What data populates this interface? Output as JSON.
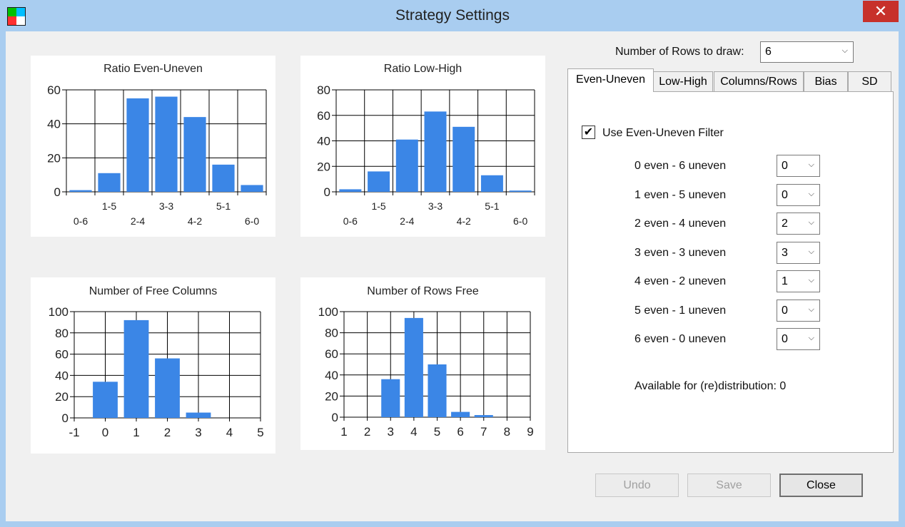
{
  "window": {
    "title": "Strategy Settings",
    "close_glyph": "✕"
  },
  "rows_to_draw": {
    "label": "Number of Rows to draw:",
    "value": "6"
  },
  "tabs": [
    {
      "label": "Even-Uneven",
      "active": true
    },
    {
      "label": "Low-High",
      "active": false
    },
    {
      "label": "Columns/Rows",
      "active": false
    },
    {
      "label": "Bias",
      "active": false
    },
    {
      "label": "SD",
      "active": false
    }
  ],
  "filter": {
    "checkbox_label": "Use Even-Uneven Filter",
    "checked": true,
    "rows": [
      {
        "label": "0 even - 6 uneven",
        "value": "0"
      },
      {
        "label": "1 even - 5 uneven",
        "value": "0"
      },
      {
        "label": "2 even - 4 uneven",
        "value": "2"
      },
      {
        "label": "3 even - 3 uneven",
        "value": "3"
      },
      {
        "label": "4 even - 2 uneven",
        "value": "1"
      },
      {
        "label": "5 even - 1 uneven",
        "value": "0"
      },
      {
        "label": "6 even - 0 uneven",
        "value": "0"
      }
    ],
    "available": "Available for (re)distribution: 0"
  },
  "buttons": {
    "undo": "Undo",
    "save": "Save",
    "close": "Close"
  },
  "chart_data": [
    {
      "type": "bar",
      "title": "Ratio Even-Uneven",
      "categories": [
        "0-6",
        "1-5",
        "2-4",
        "3-3",
        "4-2",
        "5-1",
        "6-0"
      ],
      "values": [
        1,
        11,
        55,
        56,
        44,
        16,
        4
      ],
      "ylim": [
        0,
        60
      ],
      "yticks": [
        0,
        20,
        40,
        60
      ],
      "grid": true
    },
    {
      "type": "bar",
      "title": "Ratio Low-High",
      "categories": [
        "0-6",
        "1-5",
        "2-4",
        "3-3",
        "4-2",
        "5-1",
        "6-0"
      ],
      "values": [
        2,
        16,
        41,
        63,
        51,
        13,
        1
      ],
      "ylim": [
        0,
        80
      ],
      "yticks": [
        0,
        20,
        40,
        60,
        80
      ],
      "grid": true
    },
    {
      "type": "bar",
      "title": "Number of Free Columns",
      "x": [
        0,
        1,
        2,
        3
      ],
      "values": [
        34,
        92,
        56,
        5
      ],
      "xlim": [
        -1,
        5
      ],
      "xticks": [
        "-1",
        "0",
        "1",
        "2",
        "3",
        "4",
        "5"
      ],
      "ylim": [
        0,
        100
      ],
      "yticks": [
        0,
        20,
        40,
        60,
        80,
        100
      ],
      "grid": true
    },
    {
      "type": "bar",
      "title": "Number of Rows Free",
      "x": [
        3,
        4,
        5,
        6,
        7
      ],
      "values": [
        36,
        94,
        50,
        5,
        2
      ],
      "xlim": [
        1,
        9
      ],
      "xticks": [
        "1",
        "2",
        "3",
        "4",
        "5",
        "6",
        "7",
        "8",
        "9"
      ],
      "ylim": [
        0,
        100
      ],
      "yticks": [
        0,
        20,
        40,
        60,
        80,
        100
      ],
      "grid": true
    }
  ]
}
